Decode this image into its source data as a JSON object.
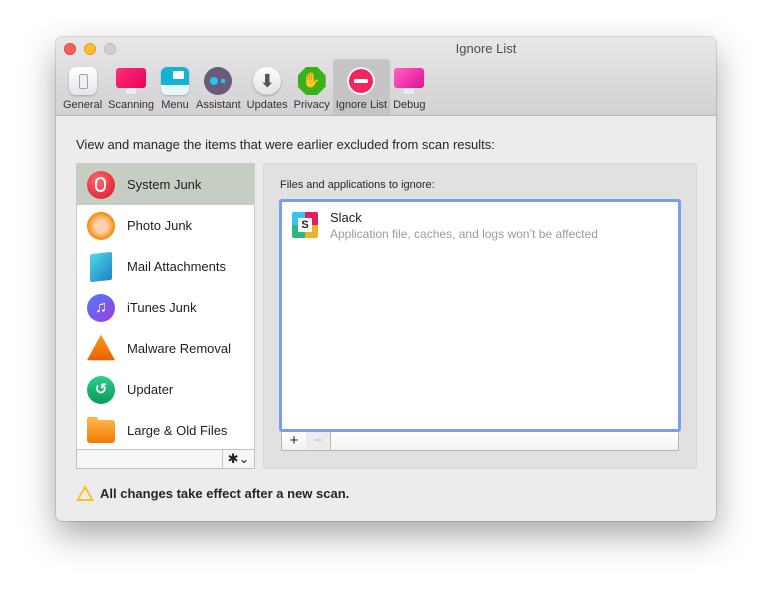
{
  "window": {
    "title": "Ignore List"
  },
  "toolbar": {
    "items": [
      {
        "label": "General",
        "icon": "general-icon"
      },
      {
        "label": "Scanning",
        "icon": "scanning-monitor-icon"
      },
      {
        "label": "Menu",
        "icon": "menu-icon"
      },
      {
        "label": "Assistant",
        "icon": "assistant-icon"
      },
      {
        "label": "Updates",
        "icon": "download-arrow-icon"
      },
      {
        "label": "Privacy",
        "icon": "hand-stop-icon"
      },
      {
        "label": "Ignore List",
        "icon": "no-entry-icon",
        "active": true
      },
      {
        "label": "Debug",
        "icon": "debug-monitor-icon"
      }
    ]
  },
  "main": {
    "intro": "View and manage the items that were earlier excluded from scan results:",
    "categories": [
      {
        "label": "System Junk",
        "icon": "system-junk-icon",
        "selected": true
      },
      {
        "label": "Photo Junk",
        "icon": "photo-junk-icon"
      },
      {
        "label": "Mail Attachments",
        "icon": "mail-attachments-icon"
      },
      {
        "label": "iTunes Junk",
        "icon": "itunes-icon"
      },
      {
        "label": "Malware Removal",
        "icon": "biohazard-icon"
      },
      {
        "label": "Updater",
        "icon": "updater-icon"
      },
      {
        "label": "Large & Old Files",
        "icon": "large-files-folder-icon"
      }
    ],
    "gear_glyph": "✱⌄",
    "ignore_panel": {
      "label": "Files and applications to ignore:",
      "items": [
        {
          "name": "Slack",
          "description": "Application file, caches, and logs won’t be affected",
          "icon": "slack-icon",
          "icon_letter": "S"
        }
      ],
      "add_glyph": "+",
      "remove_glyph": "−"
    },
    "footer_note": "All changes take effect after a new scan."
  },
  "glyphs": {
    "updates": "⬇",
    "privacy": "✋",
    "itunes": "♫",
    "updater": "↺"
  }
}
